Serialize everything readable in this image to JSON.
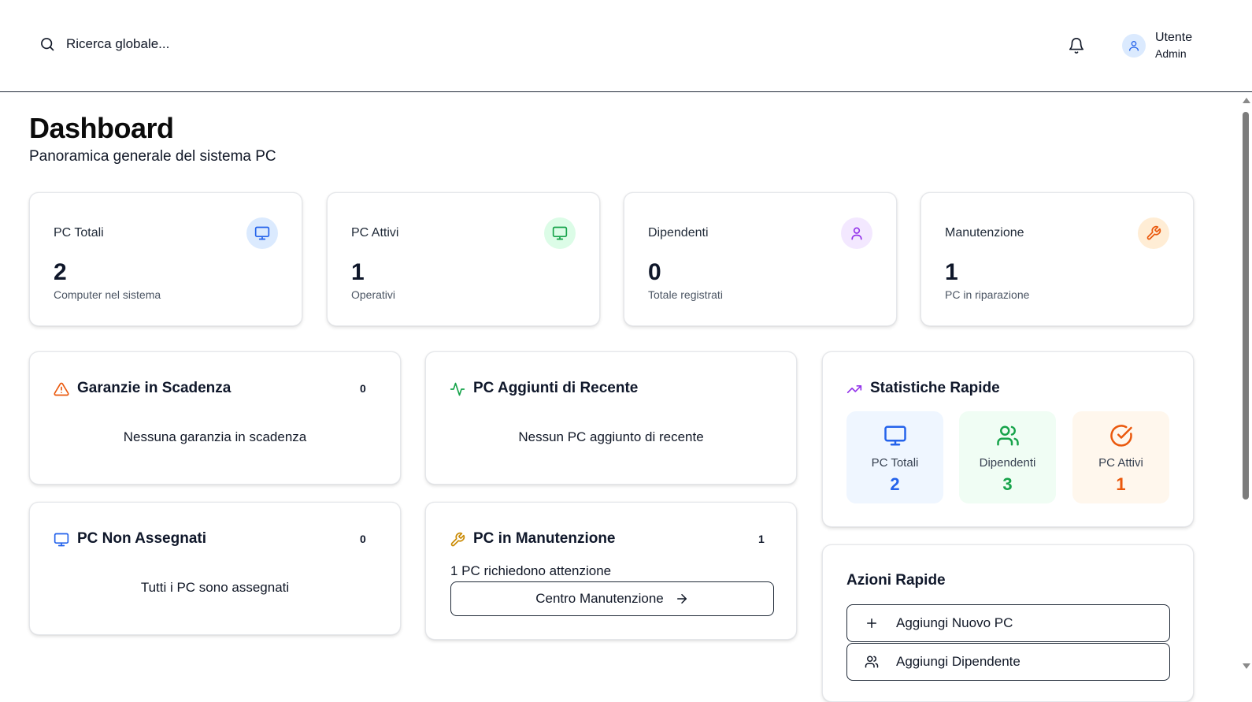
{
  "header": {
    "search_placeholder": "Ricerca globale...",
    "user_name": "Utente",
    "user_role": "Admin"
  },
  "page": {
    "title": "Dashboard",
    "subtitle": "Panoramica generale del sistema PC"
  },
  "stats": [
    {
      "label": "PC Totali",
      "value": "2",
      "desc": "Computer nel sistema",
      "icon": "monitor-icon",
      "icon_color": "#2563eb",
      "icon_bg": "#dbeafe"
    },
    {
      "label": "PC Attivi",
      "value": "1",
      "desc": "Operativi",
      "icon": "monitor-icon",
      "icon_color": "#16a34a",
      "icon_bg": "#dcfce7"
    },
    {
      "label": "Dipendenti",
      "value": "0",
      "desc": "Totale registrati",
      "icon": "user-icon",
      "icon_color": "#9333ea",
      "icon_bg": "#f3e8ff"
    },
    {
      "label": "Manutenzione",
      "value": "1",
      "desc": "PC in riparazione",
      "icon": "wrench-icon",
      "icon_color": "#ea580c",
      "icon_bg": "#ffedd5"
    }
  ],
  "panels": {
    "warranties": {
      "title": "Garanzie in Scadenza",
      "count": "0",
      "empty": "Nessuna garanzia in scadenza"
    },
    "recent": {
      "title": "PC Aggiunti di Recente",
      "empty": "Nessun PC aggiunto di recente"
    },
    "unassigned": {
      "title": "PC Non Assegnati",
      "count": "0",
      "empty": "Tutti i PC sono assegnati"
    },
    "maintenance": {
      "title": "PC in Manutenzione",
      "count": "1",
      "message": "1 PC richiedono attenzione",
      "button": "Centro Manutenzione"
    }
  },
  "quick_stats": {
    "title": "Statistiche Rapide",
    "items": [
      {
        "label": "PC Totali",
        "value": "2",
        "color": "#2563eb",
        "bg": "#eff6ff"
      },
      {
        "label": "Dipendenti",
        "value": "3",
        "color": "#16a34a",
        "bg": "#f0fdf4"
      },
      {
        "label": "PC Attivi",
        "value": "1",
        "color": "#ea580c",
        "bg": "#fff7ed"
      }
    ]
  },
  "quick_actions": {
    "title": "Azioni Rapide",
    "items": [
      {
        "label": "Aggiungi Nuovo PC",
        "icon": "plus-icon"
      },
      {
        "label": "Aggiungi Dipendente",
        "icon": "users-icon"
      }
    ]
  }
}
